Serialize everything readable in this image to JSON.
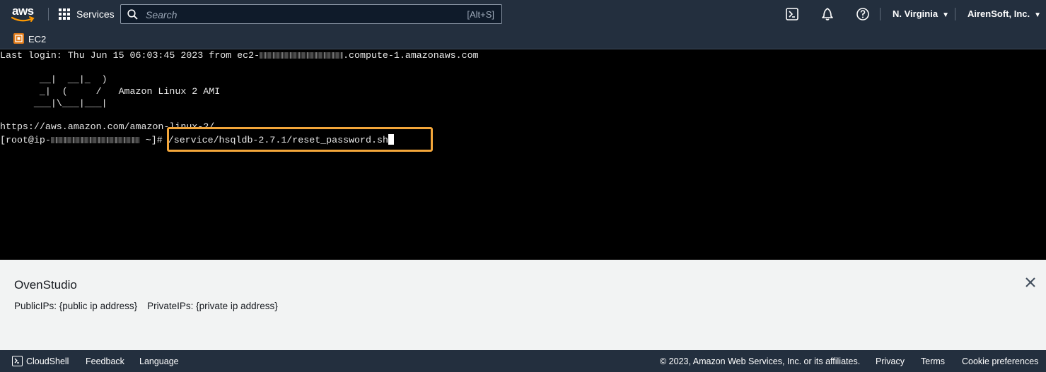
{
  "nav": {
    "logo": "aws",
    "services_label": "Services",
    "search_placeholder": "Search",
    "search_shortcut": "[Alt+S]",
    "region": "N. Virginia",
    "account": "AirenSoft, Inc."
  },
  "breadcrumb": {
    "service": "EC2"
  },
  "terminal": {
    "last_login_prefix": "Last login: Thu Jun 15 06:03:45 2023 from ec2-",
    "last_login_suffix": ".compute-1.amazonaws.com",
    "ascii_line1": "       __|  __|_  )",
    "ascii_line2": "       _|  (     /   Amazon Linux 2 AMI",
    "ascii_line3": "      ___|\\___|___|",
    "url_line": "https://aws.amazon.com/amazon-linux-2/",
    "prompt_prefix": "[root@ip-",
    "prompt_suffix": " ~]# ",
    "command": "/service/hsqldb-2.7.1/reset_password.sh"
  },
  "instance_panel": {
    "name": "OvenStudio",
    "public_ips": "PublicIPs: {public ip address}",
    "private_ips": "PrivateIPs: {private ip address}"
  },
  "footer": {
    "cloudshell": "CloudShell",
    "feedback": "Feedback",
    "language": "Language",
    "copyright": "© 2023, Amazon Web Services, Inc. or its affiliates.",
    "privacy": "Privacy",
    "terms": "Terms",
    "cookie": "Cookie preferences"
  },
  "colors": {
    "nav_bg": "#232f3e",
    "terminal_bg": "#000000",
    "highlight": "#f3a63a",
    "ec2_orange": "#e07b1a"
  }
}
